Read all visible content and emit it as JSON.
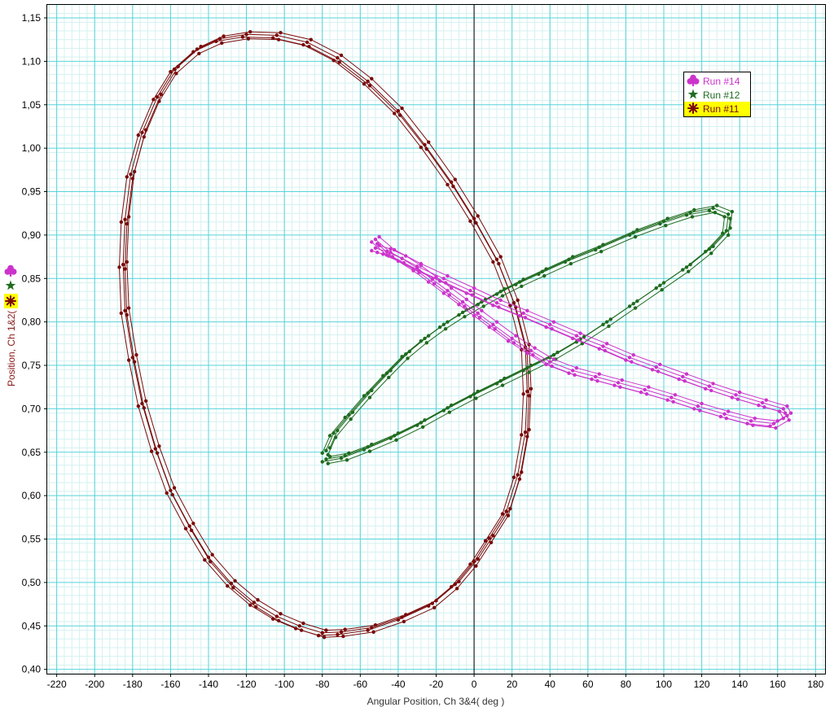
{
  "chart_data": {
    "type": "scatter",
    "title": "",
    "xlabel": "Angular Position, Ch 3&4( deg )",
    "ylabel": "Position, Ch 1&2( m )",
    "xlim": [
      -225,
      185
    ],
    "ylim": [
      0.395,
      1.165
    ],
    "x_ticks": [
      -220,
      -200,
      -180,
      -160,
      -140,
      -120,
      -100,
      -80,
      -60,
      -40,
      -20,
      0,
      20,
      40,
      60,
      80,
      100,
      120,
      140,
      160,
      180
    ],
    "x_tick_labels": [
      "-220",
      "-200",
      "-180",
      "-160",
      "-140",
      "-120",
      "-100",
      "-80",
      "-60",
      "-40",
      "-20",
      "0",
      "20",
      "40",
      "60",
      "80",
      "100",
      "120",
      "140",
      "160",
      "180"
    ],
    "y_ticks": [
      0.4,
      0.45,
      0.5,
      0.55,
      0.6,
      0.65,
      0.7,
      0.75,
      0.8,
      0.85,
      0.9,
      0.95,
      1.0,
      1.05,
      1.1,
      1.15
    ],
    "y_tick_labels": [
      "0,40",
      "0,45",
      "0,50",
      "0,55",
      "0,60",
      "0,65",
      "0,70",
      "0,75",
      "0,80",
      "0,85",
      "0,90",
      "0,95",
      "1,00",
      "1,05",
      "1,10",
      "1,15"
    ],
    "grid": true,
    "minor_grid": true,
    "legend_position": "top-right",
    "series": [
      {
        "name": "Run #14",
        "color": "#cc33cc",
        "marker": "club",
        "x": [
          -52,
          -46,
          -38,
          -30,
          -22,
          -14,
          -6,
          2,
          10,
          20,
          30,
          40,
          52,
          64,
          76,
          90,
          104,
          118,
          132,
          146,
          158,
          165,
          163,
          152,
          138,
          124,
          110,
          96,
          82,
          68,
          54,
          40,
          26,
          12,
          -2,
          -16,
          -30,
          -44,
          -52
        ],
        "y": [
          0.885,
          0.881,
          0.873,
          0.862,
          0.849,
          0.836,
          0.823,
          0.81,
          0.797,
          0.781,
          0.767,
          0.754,
          0.744,
          0.737,
          0.73,
          0.722,
          0.713,
          0.703,
          0.694,
          0.686,
          0.683,
          0.692,
          0.7,
          0.707,
          0.716,
          0.726,
          0.737,
          0.748,
          0.759,
          0.772,
          0.784,
          0.797,
          0.81,
          0.822,
          0.836,
          0.85,
          0.864,
          0.88,
          0.895
        ]
      },
      {
        "name": "Run #12",
        "color": "#1f6b1f",
        "marker": "star",
        "x": [
          -78,
          -74,
          -66,
          -56,
          -46,
          -36,
          -26,
          -16,
          -6,
          4,
          14,
          24,
          36,
          50,
          66,
          84,
          100,
          114,
          126,
          134,
          133,
          124,
          112,
          98,
          84,
          70,
          56,
          42,
          28,
          14,
          0,
          -14,
          -28,
          -42,
          -56,
          -68,
          -78
        ],
        "y": [
          0.652,
          0.672,
          0.693,
          0.718,
          0.741,
          0.763,
          0.781,
          0.797,
          0.811,
          0.823,
          0.835,
          0.846,
          0.858,
          0.872,
          0.886,
          0.903,
          0.916,
          0.926,
          0.931,
          0.924,
          0.905,
          0.884,
          0.863,
          0.842,
          0.821,
          0.8,
          0.78,
          0.762,
          0.747,
          0.732,
          0.717,
          0.701,
          0.684,
          0.669,
          0.656,
          0.646,
          0.642
        ]
      },
      {
        "name": "Run #11",
        "color": "#7a0a0a",
        "marker": "asterisk",
        "x": [
          -80,
          -92,
          -104,
          -116,
          -128,
          -140,
          -150,
          -160,
          -168,
          -175,
          -180,
          -184,
          -185,
          -184,
          -181,
          -175,
          -167,
          -158,
          -146,
          -134,
          -120,
          -104,
          -88,
          -72,
          -56,
          -40,
          -26,
          -12,
          0,
          12,
          21,
          27,
          28,
          27,
          23,
          17,
          8,
          0,
          -10,
          -22,
          -38,
          -54,
          -70,
          -80
        ],
        "y": [
          0.442,
          0.45,
          0.461,
          0.477,
          0.499,
          0.529,
          0.565,
          0.606,
          0.654,
          0.706,
          0.759,
          0.813,
          0.866,
          0.918,
          0.97,
          1.018,
          1.059,
          1.091,
          1.114,
          1.126,
          1.131,
          1.13,
          1.122,
          1.104,
          1.077,
          1.043,
          1.004,
          0.961,
          0.919,
          0.872,
          0.822,
          0.771,
          0.72,
          0.673,
          0.624,
          0.582,
          0.551,
          0.524,
          0.498,
          0.476,
          0.46,
          0.448,
          0.443,
          0.442
        ]
      }
    ]
  }
}
